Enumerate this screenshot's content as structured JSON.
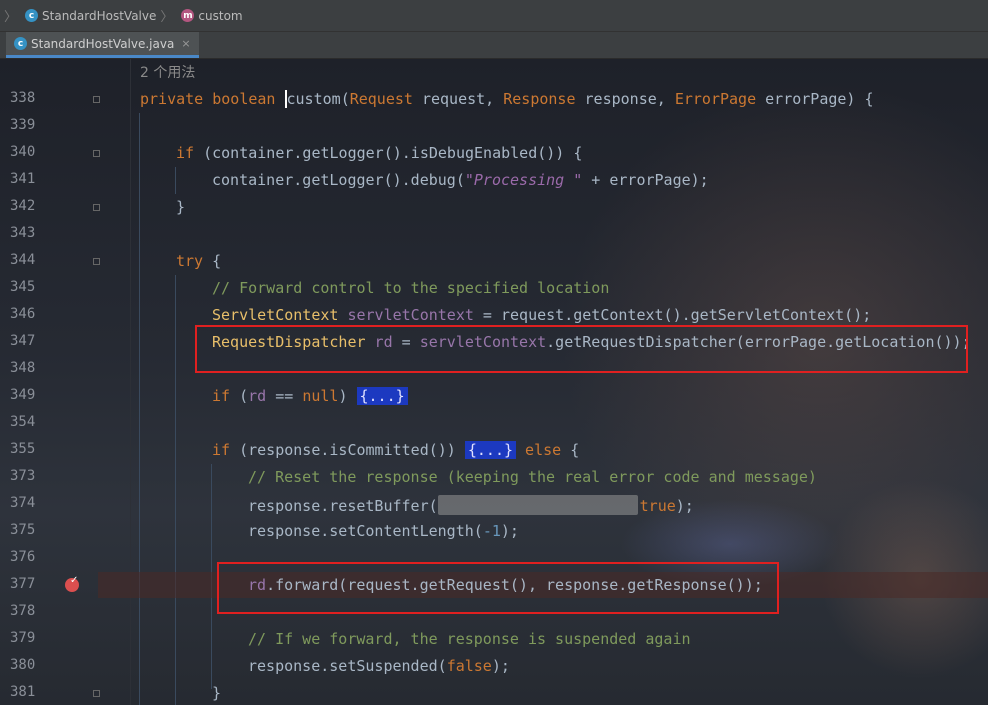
{
  "breadcrumb": {
    "class_name": "StandardHostValve",
    "method_name": "custom",
    "class_icon_letter": "c",
    "method_icon_letter": "m"
  },
  "tab": {
    "file_name": "StandardHostValve.java",
    "close_glyph": "×",
    "icon_letter": "c"
  },
  "editor": {
    "usages_hint": "2 个用法",
    "lines": {
      "l338": {
        "num": "338"
      },
      "l339": {
        "num": "339"
      },
      "l340": {
        "num": "340"
      },
      "l341": {
        "num": "341"
      },
      "l342": {
        "num": "342"
      },
      "l343": {
        "num": "343"
      },
      "l344": {
        "num": "344"
      },
      "l345": {
        "num": "345"
      },
      "l346": {
        "num": "346"
      },
      "l347": {
        "num": "347"
      },
      "l348": {
        "num": "348"
      },
      "l349": {
        "num": "349"
      },
      "l354": {
        "num": "354"
      },
      "l355": {
        "num": "355"
      },
      "l373": {
        "num": "373"
      },
      "l374": {
        "num": "374"
      },
      "l375": {
        "num": "375"
      },
      "l376": {
        "num": "376"
      },
      "l377": {
        "num": "377"
      },
      "l378": {
        "num": "378"
      },
      "l379": {
        "num": "379"
      },
      "l380": {
        "num": "380"
      },
      "l381": {
        "num": "381"
      }
    },
    "tokens": {
      "t338a": "private boolean ",
      "t338b": "custom",
      "t338c": "(",
      "t338d": "Request",
      "t338e": " request, ",
      "t338f": "Response",
      "t338g": " response, ",
      "t338h": "ErrorPage",
      "t338i": " errorPage) {",
      "t340a": "if",
      "t340b": " (container.getLogger().isDebugEnabled()) {",
      "t341a": "container.getLogger().debug(",
      "t341b": "\"Processing \"",
      "t341c": " + errorPage);",
      "t342": "}",
      "t344a": "try",
      "t344b": " {",
      "t345": "// Forward control to the specified location",
      "t346a": "ServletContext",
      "t346b": " servletContext",
      "t346c": " = request.getContext().getServletContext();",
      "t347a": "RequestDispatcher",
      "t347b": " rd",
      "t347c": " = ",
      "t347d": "servletContext",
      "t347e": ".getRequestDispatcher(errorPage.getLocation());",
      "t349a": "if",
      "t349b": " (",
      "t349c": "rd",
      "t349d": " == ",
      "t349e": "null",
      "t349f": ") ",
      "t349g": "{...}",
      "t355a": "if",
      "t355b": " (response.isCommitted()) ",
      "t355c": "{...}",
      "t355d": " else",
      "t355e": " {",
      "t373": "// Reset the response (keeping the real error code and message)",
      "t374a": "response.resetBuffer(",
      "t374b": "true",
      "t374c": ");",
      "t375a": "response.setContentLength(",
      "t375b": "-1",
      "t375c": ");",
      "t377a": "rd",
      "t377b": ".forward(request.getRequest(), response.getResponse());",
      "t379": "// If we forward, the response is suspended again",
      "t380a": "response.setSuspended(",
      "t380b": "false",
      "t380c": ");",
      "t381": "}"
    }
  },
  "colors": {
    "keyword": "#cc7832",
    "type": "#e8bf6a",
    "field": "#9876aa",
    "comment": "#629755",
    "fold_highlight": "#1c39c0",
    "annotation_box": "#e02020",
    "breakpoint": "#db4f4f"
  }
}
